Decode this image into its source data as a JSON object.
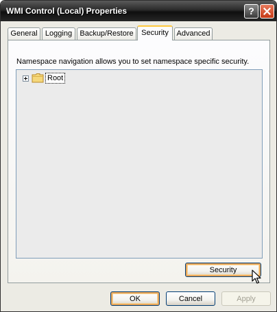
{
  "window": {
    "title": "WMI Control (Local) Properties",
    "help_label": "?"
  },
  "tabs": [
    {
      "label": "General",
      "active": false
    },
    {
      "label": "Logging",
      "active": false
    },
    {
      "label": "Backup/Restore",
      "active": false
    },
    {
      "label": "Security",
      "active": true
    },
    {
      "label": "Advanced",
      "active": false
    }
  ],
  "security_tab": {
    "description": "Namespace navigation allows you to set namespace specific security.",
    "tree": {
      "nodes": [
        {
          "label": "Root",
          "icon": "folder-icon",
          "expanded": false,
          "selected": true
        }
      ]
    },
    "security_button": "Security"
  },
  "buttons": {
    "ok": "OK",
    "cancel": "Cancel",
    "apply": "Apply"
  },
  "colors": {
    "title_bar": "#1e1e1e",
    "close_button": "#d4522e",
    "active_tab_highlight": "#ffc83c",
    "focused_button_glow": "#e8a65a"
  }
}
